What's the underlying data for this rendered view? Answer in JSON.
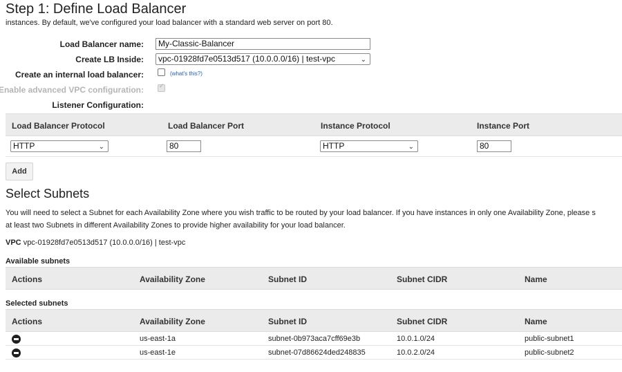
{
  "page": {
    "title": "Step 1: Define Load Balancer",
    "intro": "instances. By default, we've configured your load balancer with a standard web server on port 80."
  },
  "form": {
    "lb_name_label": "Load Balancer name:",
    "lb_name_value": "My-Classic-Balancer",
    "create_inside_label": "Create LB Inside:",
    "create_inside_value": "vpc-01928fd7e0513d517 (10.0.0.0/16) | test-vpc",
    "internal_label": "Create an internal load balancer:",
    "internal_checked": false,
    "whats_this": "(what's this?)",
    "advanced_vpc_label": "Enable advanced VPC configuration:",
    "advanced_vpc_checked": true,
    "listener_label": "Listener Configuration:"
  },
  "listeners": {
    "headers": [
      "Load Balancer Protocol",
      "Load Balancer Port",
      "Instance Protocol",
      "Instance Port"
    ],
    "row": {
      "lb_protocol": "HTTP",
      "lb_port": "80",
      "instance_protocol": "HTTP",
      "instance_port": "80"
    },
    "add_label": "Add"
  },
  "subnets": {
    "title": "Select Subnets",
    "desc_line1": "You will need to select a Subnet for each Availability Zone where you wish traffic to be routed by your load balancer. If you have instances in only one Availability Zone, please s",
    "desc_line2": "at least two Subnets in different Availability Zones to provide higher availability for your load balancer.",
    "vpc_label": "VPC",
    "vpc_value": "vpc-01928fd7e0513d517 (10.0.0.0/16) | test-vpc",
    "available_title": "Available subnets",
    "selected_title": "Selected subnets",
    "headers": [
      "Actions",
      "Availability Zone",
      "Subnet ID",
      "Subnet CIDR",
      "Name"
    ],
    "available": [],
    "selected": [
      {
        "action": "remove-icon",
        "az": "us-east-1a",
        "subnet_id": "subnet-0b973aca7cff69e3b",
        "cidr": "10.0.1.0/24",
        "name": "public-subnet1"
      },
      {
        "action": "remove-icon",
        "az": "us-east-1e",
        "subnet_id": "subnet-07d86624ded248835",
        "cidr": "10.0.2.0/24",
        "name": "public-subnet2"
      }
    ]
  }
}
